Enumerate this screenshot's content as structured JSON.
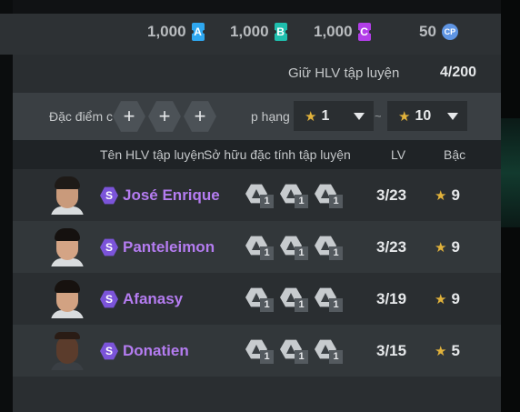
{
  "currencies": [
    {
      "amount": "1,000",
      "letter": "A",
      "color": "#2ea7f0",
      "icon": "ticket-a-icon"
    },
    {
      "amount": "1,000",
      "letter": "B",
      "color": "#1fbfae",
      "icon": "ticket-b-icon"
    },
    {
      "amount": "1,000",
      "letter": "C",
      "color": "#b23ee8",
      "icon": "ticket-c-icon"
    },
    {
      "amount": "50",
      "letter": "CP",
      "color": "#5f95e3",
      "icon": "coin-cp-icon"
    }
  ],
  "hold": {
    "label": "Giữ HLV tập luyện",
    "value": "4/200"
  },
  "filter": {
    "traits_label": "Đặc điểm c",
    "add_symbol": "+",
    "rank_label": "p hạng",
    "min_rank": "1",
    "max_rank": "10",
    "tilde": "~",
    "star_icon": "star-icon"
  },
  "table": {
    "headers": {
      "name": "Tên HLV tập luyện",
      "traits": "Sở hữu đặc tính tập luyện",
      "lv": "LV",
      "grade": "Bậc"
    },
    "rows": [
      {
        "badge": "S",
        "name": "José Enrique",
        "trait_levels": [
          "1",
          "1",
          "1"
        ],
        "lv": "3/23",
        "grade": "9"
      },
      {
        "badge": "S",
        "name": "Panteleimon",
        "trait_levels": [
          "1",
          "1",
          "1"
        ],
        "lv": "3/23",
        "grade": "9"
      },
      {
        "badge": "S",
        "name": "Afanasy",
        "trait_levels": [
          "1",
          "1",
          "1"
        ],
        "lv": "3/19",
        "grade": "9"
      },
      {
        "badge": "S",
        "name": "Donatien",
        "trait_levels": [
          "1",
          "1",
          "1"
        ],
        "lv": "3/15",
        "grade": "5"
      }
    ]
  },
  "colors": {
    "accent_name": "#b47cf0",
    "badge": "#7b54d9",
    "star": "#e1b23b"
  }
}
